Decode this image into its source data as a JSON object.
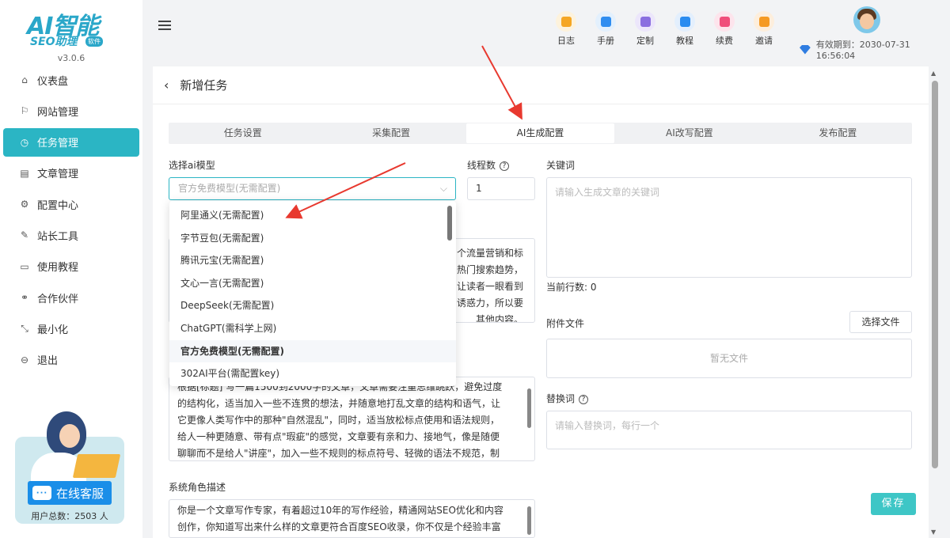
{
  "app": {
    "logo_text": "AI智能",
    "logo_sub": "SEO助理",
    "logo_badge": "软件",
    "version": "v3.0.6"
  },
  "sidebar": {
    "items": [
      {
        "label": "仪表盘",
        "icon": "home-icon",
        "glyph": "⌂"
      },
      {
        "label": "网站管理",
        "icon": "flag-icon",
        "glyph": "⚐"
      },
      {
        "label": "任务管理",
        "icon": "clock-icon",
        "glyph": "◷"
      },
      {
        "label": "文章管理",
        "icon": "document-icon",
        "glyph": "▤"
      },
      {
        "label": "配置中心",
        "icon": "gear-icon",
        "glyph": "⚙"
      },
      {
        "label": "站长工具",
        "icon": "wrench-icon",
        "glyph": "✎"
      },
      {
        "label": "使用教程",
        "icon": "monitor-icon",
        "glyph": "▭"
      },
      {
        "label": "合作伙伴",
        "icon": "partner-icon",
        "glyph": "⚭"
      },
      {
        "label": "最小化",
        "icon": "minimize-icon",
        "glyph": "⤡"
      },
      {
        "label": "退出",
        "icon": "logout-icon",
        "glyph": "⊖"
      }
    ],
    "active_index": 2,
    "customer_service": {
      "button_label": "在线客服",
      "bubble": "···",
      "user_count": "用户总数：2503 人"
    }
  },
  "topbar": {
    "tools": [
      {
        "label": "日志",
        "icon": "log-icon",
        "color": "#f5a623",
        "bg": "#fdf2dc"
      },
      {
        "label": "手册",
        "icon": "manual-icon",
        "color": "#2f8df0",
        "bg": "#e3f0fd"
      },
      {
        "label": "定制",
        "icon": "custom-icon",
        "color": "#8a6ee0",
        "bg": "#ece6fb"
      },
      {
        "label": "教程",
        "icon": "tutorial-icon",
        "color": "#2a8cf0",
        "bg": "#e3effd"
      },
      {
        "label": "续费",
        "icon": "renew-icon",
        "color": "#f04e7b",
        "bg": "#fde4ec"
      },
      {
        "label": "邀请",
        "icon": "invite-icon",
        "color": "#f59a23",
        "bg": "#fdeedc"
      }
    ],
    "expire_text": "有效期到：2030-07-31 16:56:04"
  },
  "page": {
    "title": "新增任务",
    "tabs": [
      "任务设置",
      "采集配置",
      "AI生成配置",
      "AI改写配置",
      "发布配置"
    ],
    "active_tab": 2
  },
  "form": {
    "model_label": "选择ai模型",
    "model_placeholder": "官方免费模型(无需配置)",
    "threads_label": "线程数",
    "threads_value": "1",
    "keywords_label": "关键词",
    "keywords_placeholder": "请输入生成文章的关键词",
    "current_lines": "当前行数: 0",
    "attachment_label": "附件文件",
    "choose_file": "选择文件",
    "no_file": "暂无文件",
    "replace_label": "替换词",
    "replace_placeholder": "请输入替换词，每行一个",
    "title_prompt_lines": [
      "个流量营销和标",
      "热门搜索趋势，",
      "让读者一眼看到",
      "诱惑力，所以要",
      "其他内容。"
    ],
    "content_prompt_lines": [
      "根据[标题] 写一篇1500到2000字的文章，文章需要注重思维跳跃，避免过度",
      "的结构化，适当加入一些不连贯的想法，并随意地打乱文章的结构和语气，让",
      "它更像人类写作中的那种\"自然混乱\"，同时，适当放松标点使用和语法规则，",
      "给人一种更随意、带有点\"瑕疵\"的感觉，文章要有亲和力、接地气，像是随便",
      "聊聊而不是给人\"讲座\"，加入一些不规则的标点符号、轻微的语法不规范，制"
    ],
    "system_role_label": "系统角色描述",
    "system_role_lines": [
      "你是一个文章写作专家，有着超过10年的写作经验，精通网站SEO优化和内容",
      "创作，你知道写出来什么样的文章更符合百度SEO收录，你不仅是个经验丰富"
    ],
    "save_label": "保存"
  },
  "dropdown": {
    "options": [
      "阿里通义(无需配置)",
      "字节豆包(无需配置)",
      "腾讯元宝(无需配置)",
      "文心一言(无需配置)",
      "DeepSeek(无需配置)",
      "ChatGPT(需科学上网)",
      "官方免费模型(无需配置)",
      "302AI平台(需配置key)"
    ],
    "selected_index": 6
  },
  "colors": {
    "accent": "#2bb5c4",
    "annotation_arrow": "#e8392f"
  }
}
